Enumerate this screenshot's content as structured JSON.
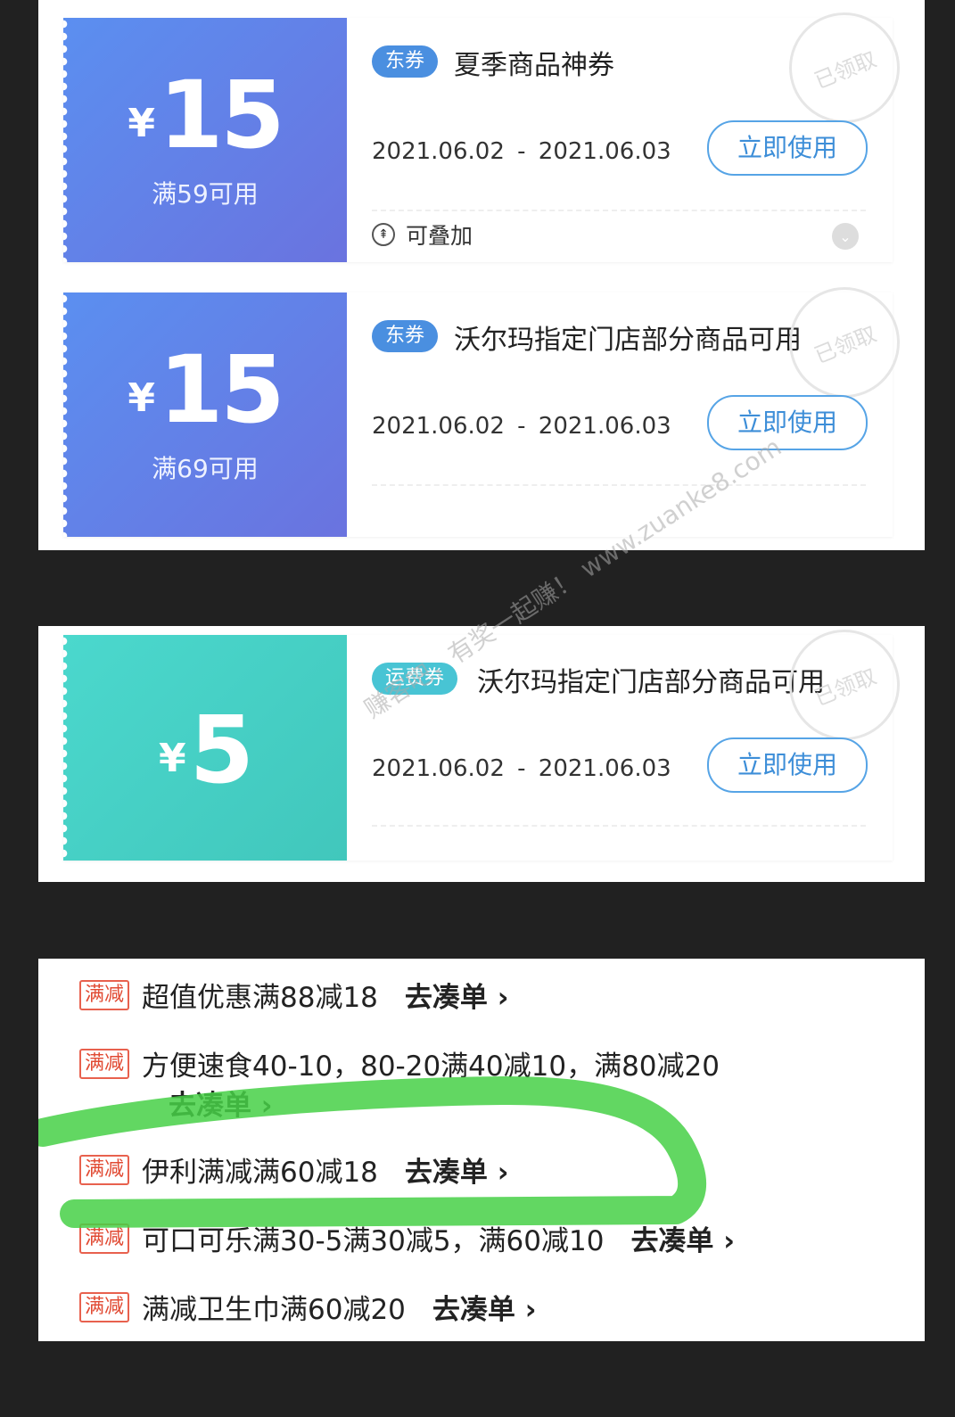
{
  "coupons": [
    {
      "currency": "¥",
      "amount": "15",
      "condition": "满59可用",
      "tag": "东券",
      "title": "夏季商品神券",
      "date_start": "2021.06.02",
      "date_sep": "-",
      "date_end": "2021.06.03",
      "button": "立即使用",
      "stack_label": "可叠加",
      "stamp": "已领取"
    },
    {
      "currency": "¥",
      "amount": "15",
      "condition": "满69可用",
      "tag": "东券",
      "title": "沃尔玛指定门店部分商品可用",
      "date_start": "2021.06.02",
      "date_sep": "-",
      "date_end": "2021.06.03",
      "button": "立即使用",
      "stamp": "已领取"
    },
    {
      "currency": "¥",
      "amount": "5",
      "tag": "运费券",
      "title": "沃尔玛指定门店部分商品可用",
      "date_start": "2021.06.02",
      "date_sep": "-",
      "date_end": "2021.06.03",
      "button": "立即使用",
      "stamp": "已领取"
    }
  ],
  "promotions": [
    {
      "tag": "满减",
      "text": "超值优惠满88减18",
      "link": "去凑单 ›"
    },
    {
      "tag": "满减",
      "text": "方便速食40-10，80-20满40减10，满80减20",
      "link": "去凑单 ›"
    },
    {
      "tag": "满减",
      "text": "伊利满减满60减18",
      "link": "去凑单 ›"
    },
    {
      "tag": "满减",
      "text": "可口可乐满30-5满30减5，满60减10",
      "link": "去凑单 ›"
    },
    {
      "tag": "满减",
      "text": "满减卫生巾满60减20",
      "link": "去凑单 ›"
    }
  ],
  "watermark": "赚客吧，有奖一起赚！ www.zuanke8.com",
  "colors": {
    "background": "#212121",
    "coupon_blue": "#6380e8",
    "coupon_teal": "#45cfc4",
    "button_blue": "#3d8ed8",
    "promo_red": "#e14b34",
    "highlight_green": "#46d046"
  }
}
